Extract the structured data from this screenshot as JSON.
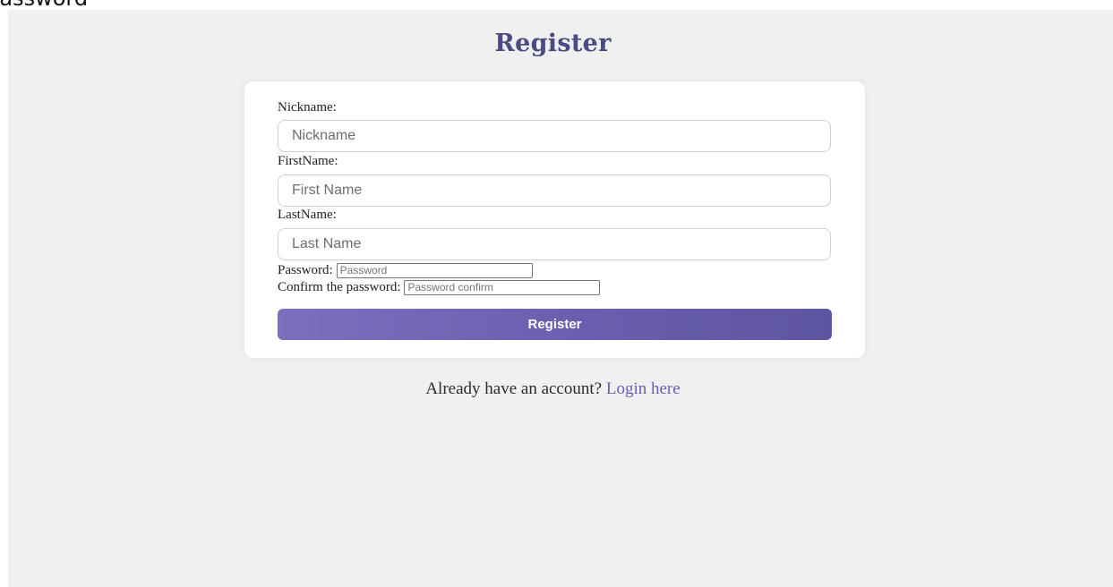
{
  "page": {
    "top_fragment": "Password",
    "title": "Register"
  },
  "form": {
    "nickname": {
      "label": "Nickname:",
      "placeholder": "Nickname",
      "value": ""
    },
    "firstname": {
      "label": "FirstName:",
      "placeholder": "First Name",
      "value": ""
    },
    "lastname": {
      "label": "LastName:",
      "placeholder": "Last Name",
      "value": ""
    },
    "password": {
      "label": "Password:",
      "placeholder": "Password",
      "value": ""
    },
    "password_confirm": {
      "label": "Confirm the password:",
      "placeholder": "Password confirm",
      "value": ""
    },
    "submit_label": "Register"
  },
  "footer": {
    "prompt": "Already have an account?",
    "link_label": "Login here"
  },
  "colors": {
    "accent": "#6a60b0",
    "title": "#4b4a82",
    "background": "#f0f0f0",
    "card": "#ffffff"
  }
}
